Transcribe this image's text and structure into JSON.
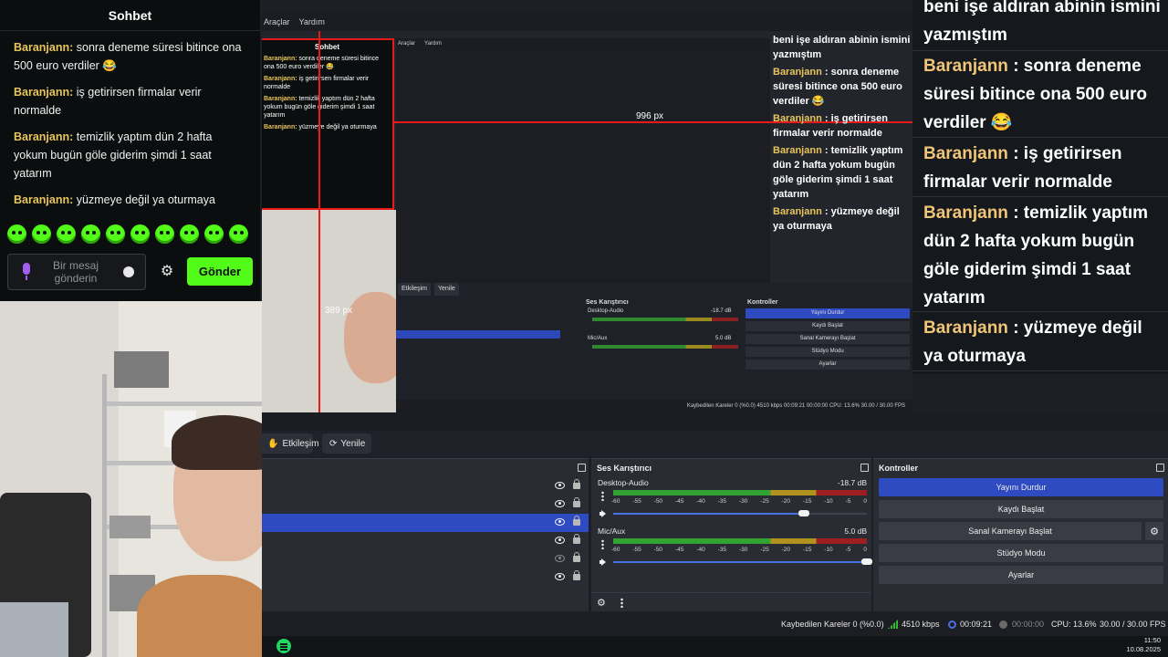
{
  "chat": {
    "title": "Sohbet",
    "messages": [
      {
        "user": "Baranjann:",
        "text": " sonra deneme süresi bitince ona 500 euro verdiler 😂"
      },
      {
        "user": "Baranjann:",
        "text": " iş getirirsen firmalar verir normalde"
      },
      {
        "user": "Baranjann:",
        "text": " temizlik yaptım dün 2 hafta yokum bugün göle giderim şimdi 1 saat yatarım"
      },
      {
        "user": "Baranjann:",
        "text": " yüzmeye değil ya oturmaya"
      }
    ],
    "input_placeholder": "Bir mesaj gönderin",
    "send_label": "Gönder",
    "accent_color": "#53fc18"
  },
  "nested": {
    "menu": [
      "Araçlar",
      "Yardım"
    ],
    "inner_menu": [
      "Araçlar",
      "Yardım"
    ],
    "px_h": "996 px",
    "px_v": "389 px",
    "chat_title": "Sohbet",
    "chat_messages": [
      {
        "user": "Baranjann:",
        "text": " sonra deneme süresi bitince ona 500 euro verdiler 😂"
      },
      {
        "user": "Baranjann:",
        "text": " iş getirirsen firmalar verir normalde"
      },
      {
        "user": "Baranjann:",
        "text": " temizlik yaptım dün 2 hafta yokum bugün göle giderim şimdi 1 saat yatarım"
      },
      {
        "user": "Baranjann:",
        "text": " yüzmeye değil ya oturmaya"
      }
    ],
    "right_messages": [
      {
        "user": "",
        "text": "beni işe aldıran abinin ismini yazmıştım"
      },
      {
        "user": "Baranjann",
        "text": " : sonra deneme süresi bitince ona 500 euro verdiler 😂"
      },
      {
        "user": "Baranjann",
        "text": " : iş getirirsen firmalar verir normalde"
      },
      {
        "user": "Baranjann",
        "text": " : temizlik yaptım dün 2 hafta yokum bugün göle giderim şimdi 1 saat yatarım"
      },
      {
        "user": "Baranjann",
        "text": " : yüzmeye değil ya oturmaya"
      }
    ],
    "btn_interact": "Etkileşim",
    "btn_refresh": "Yenile",
    "mixer_title": "Ses Karıştırıcı",
    "controls_title": "Kontroller",
    "desktop_audio": "Desktop-Audio",
    "desktop_db": "-18.7 dB",
    "mic_aux": "Mic/Aux",
    "mic_db": "5.0 dB",
    "controls": [
      "Yayını Durdur",
      "Kaydı Başlat",
      "Sanal Kamerayı Başlat",
      "Stüdyo Modu",
      "Ayarlar"
    ],
    "status": "Kaybedilen Kareler 0 (%0.0)   4510 kbps   00:09:21   00:00:00   CPU: 13.6%   30.00 / 30.00 FPS",
    "clock_time": "11:50",
    "clock_date": "10.08.2025"
  },
  "right_chat": {
    "messages": [
      {
        "user": "",
        "text": "beni işe aldıran abinin ismini yazmıştım"
      },
      {
        "user": "Baranjann",
        "text": " : sonra deneme süresi bitince ona 500 euro verdiler 😂"
      },
      {
        "user": "Baranjann",
        "text": " : iş getirirsen firmalar verir normalde"
      },
      {
        "user": "Baranjann",
        "text": " : temizlik yaptım dün 2 hafta yokum bugün göle giderim şimdi 1 saat yatarım"
      },
      {
        "user": "Baranjann",
        "text": " : yüzmeye değil ya oturmaya"
      }
    ],
    "username_color": "#f0c676"
  },
  "toolbar": {
    "interact_label": "Etkileşim",
    "refresh_label": "Yenile"
  },
  "mixer": {
    "title": "Ses Karıştırıcı",
    "tracks": [
      {
        "name": "Desktop-Audio",
        "db": "-18.7 dB",
        "level": 0.78,
        "volume": 0.75
      },
      {
        "name": "Mic/Aux",
        "db": "5.0 dB",
        "level": 0.83,
        "volume": 1.0
      }
    ],
    "scale": [
      "-60",
      "-55",
      "-50",
      "-45",
      "-40",
      "-35",
      "-30",
      "-25",
      "-20",
      "-15",
      "-10",
      "-5",
      "0"
    ]
  },
  "controls": {
    "title": "Kontroller",
    "stop_stream": "Yayını Durdur",
    "start_record": "Kaydı Başlat",
    "start_virtualcam": "Sanal Kamerayı Başlat",
    "studio_mode": "Stüdyo Modu",
    "settings": "Ayarlar"
  },
  "status": {
    "dropped_frames": "Kaybedilen Kareler 0 (%0.0)",
    "bitrate": "4510 kbps",
    "live_time": "00:09:21",
    "rec_time": "00:00:00",
    "cpu": "CPU: 13.6%",
    "fps": "30.00 / 30.00 FPS"
  },
  "clock": {
    "time": "11:50",
    "date": "10.08.2025"
  },
  "icons": [
    "microphone-icon",
    "smile-icon",
    "gear-icon",
    "eye-icon",
    "lock-icon",
    "speaker-icon",
    "kebab-icon",
    "signal-icon",
    "spotify-icon",
    "refresh-icon",
    "hand-icon"
  ]
}
